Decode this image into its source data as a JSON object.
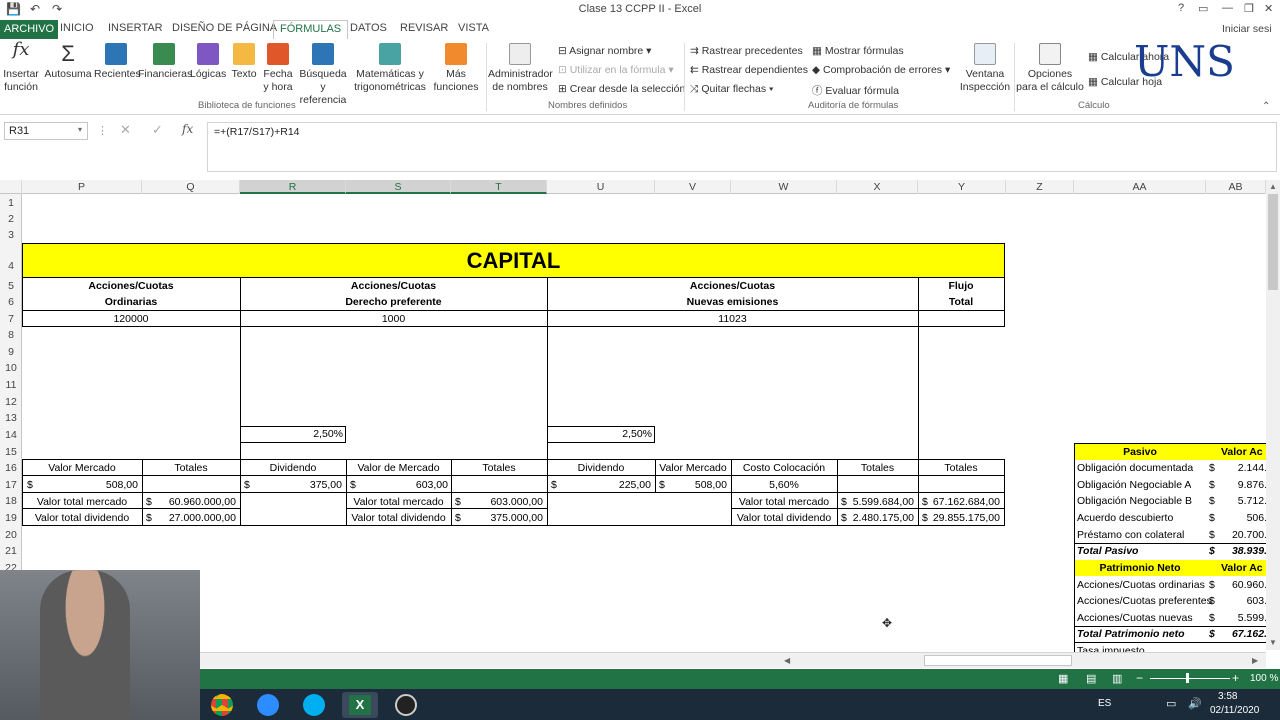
{
  "window": {
    "title": "Clase 13 CCPP II - Excel",
    "signin": "Iniciar sesi",
    "help": "?"
  },
  "tabs": [
    "ARCHIVO",
    "INICIO",
    "INSERTAR",
    "DISEÑO DE PÁGINA",
    "FÓRMULAS",
    "DATOS",
    "REVISAR",
    "VISTA"
  ],
  "ribbon": {
    "insert_function": "Insertar función",
    "autosum": "Autosuma",
    "recent": "Recientes",
    "financial": "Financieras",
    "logical": "Lógicas",
    "text": "Texto",
    "datetime": "Fecha y hora",
    "lookup": "Búsqueda y referencia",
    "math": "Matemáticas y trigonométricas",
    "more": "Más funciones",
    "lib_group": "Biblioteca de funciones",
    "name_manager": "Administrador de nombres",
    "define_name": "Asignar nombre",
    "use_in_formula": "Utilizar en la fórmula",
    "create_from_sel": "Crear desde la selección",
    "names_group": "Nombres definidos",
    "trace_prec": "Rastrear precedentes",
    "trace_dep": "Rastrear dependientes",
    "remove_arrows": "Quitar flechas",
    "show_formulas": "Mostrar fórmulas",
    "error_check": "Comprobación de errores",
    "eval_formula": "Evaluar fórmula",
    "watch_window": "Ventana Inspección",
    "audit_group": "Auditoría de fórmulas",
    "calc_options": "Opciones para el cálculo",
    "calc_now": "Calcular ahora",
    "calc_sheet": "Calcular hoja",
    "calc_group": "Cálculo",
    "logo": "UNS"
  },
  "formula_bar": {
    "name_box": "R31",
    "formula": "=+(R17/S17)+R14",
    "fx": "fx"
  },
  "columns": [
    "P",
    "Q",
    "R",
    "S",
    "T",
    "U",
    "V",
    "W",
    "X",
    "Y",
    "Z",
    "AA",
    "AB"
  ],
  "rows": [
    "1",
    "2",
    "3",
    "4",
    "5",
    "6",
    "7",
    "8",
    "9",
    "10",
    "11",
    "12",
    "13",
    "14",
    "15",
    "16",
    "17",
    "18",
    "19",
    "20",
    "21",
    "22"
  ],
  "sheet": {
    "title": "CAPITAL",
    "h_ord1": "Acciones/Cuotas",
    "h_ord2": "Ordinarias",
    "ord_qty": "120000",
    "h_pref1": "Acciones/Cuotas",
    "h_pref2": "Derecho preferente",
    "pref_qty": "1000",
    "h_new1": "Acciones/Cuotas",
    "h_new2": "Nuevas emisiones",
    "new_qty": "11023",
    "h_flow1": "Flujo",
    "h_flow2": "Total",
    "pref_rate": "2,50%",
    "new_rate": "2,50%",
    "l_valor_mercado": "Valor Mercado",
    "l_totales": "Totales",
    "l_dividendo": "Dividendo",
    "l_valor_de_mercado": "Valor de Mercado",
    "l_totales2": "Totales",
    "l_dividendo2": "Dividendo",
    "l_valor_mercado2": "Valor Mercado",
    "l_costo": "Costo Colocación",
    "l_totales3": "Totales",
    "l_totales4": "Totales",
    "cur": "$",
    "p17": "508,00",
    "r17": "375,00",
    "s17": "603,00",
    "u17": "225,00",
    "v17": "508,00",
    "w17": "5,60%",
    "l_vtm": "Valor total mercado",
    "l_vtd": "Valor total dividendo",
    "q18": "60.960.000,00",
    "q19": "27.000.000,00",
    "t18": "603.000,00",
    "t19": "375.000,00",
    "x18": "5.599.684,00",
    "x19": "2.480.175,00",
    "y18": "67.162.684,00",
    "y19": "29.855.175,00"
  },
  "side": {
    "pasivo": "Pasivo",
    "valor": "Valor Ac",
    "items": [
      {
        "label": "Obligación documentada",
        "v": "2.144."
      },
      {
        "label": "Obligación Negociable A",
        "v": "9.876."
      },
      {
        "label": "Obligación Negociable B",
        "v": "5.712."
      },
      {
        "label": "Acuerdo descubierto",
        "v": "506."
      },
      {
        "label": "Préstamo con colateral",
        "v": "20.700."
      }
    ],
    "total_pasivo": "Total Pasivo",
    "total_pasivo_v": "38.939.",
    "pn": "Patrimonio Neto",
    "valor2": "Valor Ac",
    "pn_items": [
      {
        "label": "Acciones/Cuotas ordinarias",
        "v": "60.960."
      },
      {
        "label": "Acciones/Cuotas preferentes",
        "v": "603."
      },
      {
        "label": "Acciones/Cuotas nuevas",
        "v": "5.599."
      }
    ],
    "total_pn": "Total Patrimonio neto",
    "total_pn_v": "67.162.",
    "cut": "Tasa impuesto"
  },
  "status": {
    "zoom": "100 %",
    "lang": "ES",
    "time": "3:58",
    "date": "02/11/2020"
  },
  "colors": {
    "excel_green": "#217346",
    "yellow": "#ffff00"
  }
}
